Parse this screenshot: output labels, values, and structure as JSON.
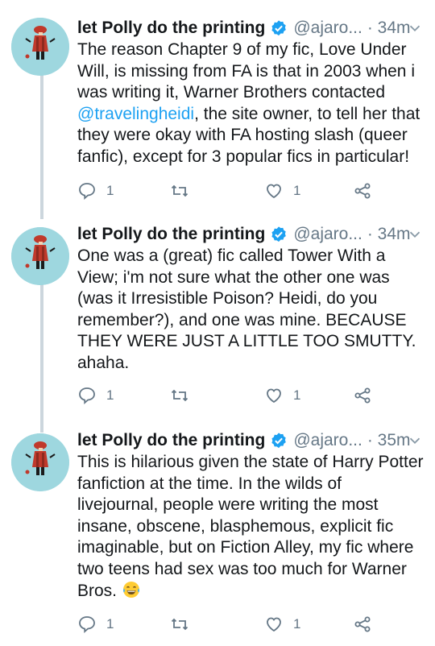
{
  "tweets": [
    {
      "name": "let Polly do the printing",
      "handle": "@ajaro...",
      "time": "· 34m",
      "body_before": "The reason Chapter 9 of my fic, Love Under Will, is missing from FA is that in 2003 when i was writing it, Warner Brothers contacted ",
      "mention": "@travelingheidi",
      "body_after": ", the site owner, to tell her that they were okay with FA hosting slash (queer fanfic), except for 3 popular fics in particular!",
      "replies": "1",
      "likes": "1"
    },
    {
      "name": "let Polly do the printing",
      "handle": "@ajaro...",
      "time": "· 34m",
      "body": "One was a (great) fic called Tower With a View; i'm not sure what the other one was (was it Irresistible Poison? Heidi, do you remember?), and one was mine. BECAUSE THEY WERE JUST A LITTLE TOO SMUTTY. ahaha.",
      "replies": "1",
      "likes": "1"
    },
    {
      "name": "let Polly do the printing",
      "handle": "@ajaro...",
      "time": "· 35m",
      "body": "This is hilarious given the state of Harry Potter fanfiction at the time. In the wilds of livejournal, people were writing the most insane, obscene, blasphemous, explicit fic imaginable, but on Fiction Alley, my fic where two teens had sex was too much for Warner Bros.",
      "emoji": "face-with-tears-of-joy",
      "replies": "1",
      "likes": "1"
    }
  ],
  "colors": {
    "text": "#14171a",
    "secondary": "#657786",
    "link": "#1da1f2",
    "verified": "#1da1f2",
    "thread_line": "#ccd6dd",
    "avatar_bg": "#9ed7df"
  }
}
